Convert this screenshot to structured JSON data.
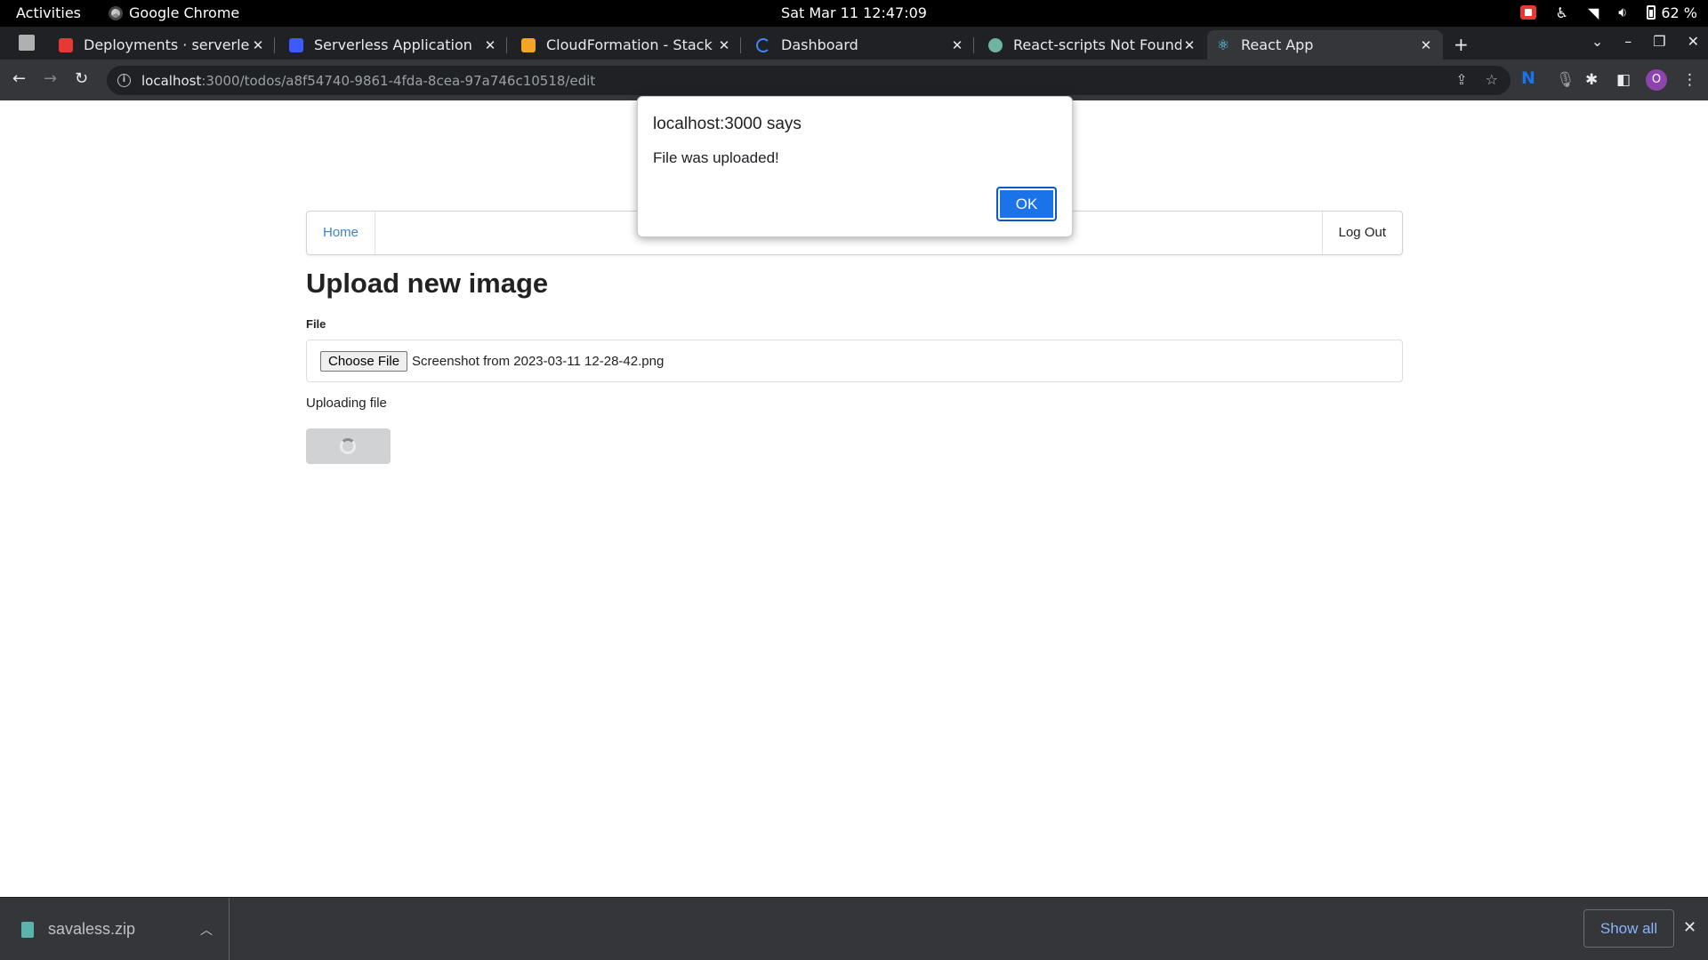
{
  "system_bar": {
    "activities": "Activities",
    "app_name": "Google Chrome",
    "clock": "Sat Mar 11  12:47:09",
    "battery": "62 %"
  },
  "tabs": [
    {
      "title": "Deployments · serverless",
      "favicon_color": "#e53935",
      "active": false
    },
    {
      "title": "Serverless Application",
      "favicon_color": "#3d5afe",
      "active": false
    },
    {
      "title": "CloudFormation - Stack s",
      "favicon_color": "#f4a623",
      "active": false
    },
    {
      "title": "Dashboard",
      "favicon_color": "#4285f4",
      "active": false
    },
    {
      "title": "React-scripts Not Found.",
      "favicon_color": "#6fb3a0",
      "active": false
    },
    {
      "title": "React App",
      "favicon_color": "#61dafb",
      "active": true
    }
  ],
  "address_bar": {
    "host": "localhost",
    "path": ":3000/todos/a8f54740-9861-4fda-8cea-97a746c10518/edit"
  },
  "profile": {
    "initial": "O",
    "color": "#8e44ad"
  },
  "nav_menu": {
    "home": "Home",
    "logout": "Log Out"
  },
  "main": {
    "heading": "Upload new image",
    "file_label": "File",
    "choose_button": "Choose File",
    "chosen_file": "Screenshot from 2023-03-11 12-28-42.png",
    "status": "Uploading file"
  },
  "dialog": {
    "title": "localhost:3000 says",
    "message": "File was uploaded!",
    "ok": "OK"
  },
  "downloads": {
    "file": "savaless.zip",
    "show_all": "Show all"
  },
  "icons": {
    "back": "arrow-left-icon",
    "forward": "arrow-right-icon",
    "reload": "reload-icon",
    "share": "share-icon",
    "bookmark": "star-icon",
    "extensions": "puzzle-icon",
    "sidepanel": "side-panel-icon",
    "menu": "kebab-menu-icon"
  }
}
